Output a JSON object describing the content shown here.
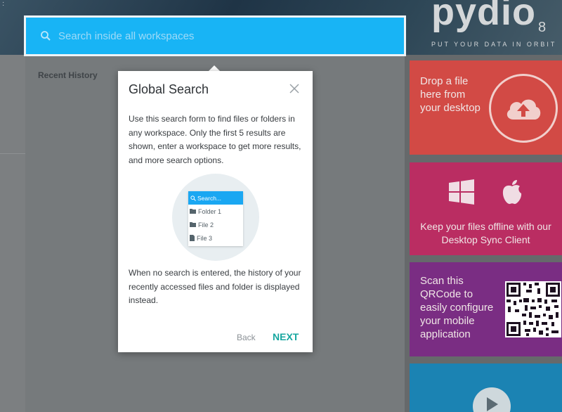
{
  "brand": {
    "logo_text": "pydio",
    "version": "8",
    "tagline": "PUT YOUR DATA IN ORBIT"
  },
  "search": {
    "placeholder": "Search inside all workspaces"
  },
  "sidebar": {
    "recent_history_label": "Recent History"
  },
  "modal": {
    "title": "Global Search",
    "intro": "Use this search form to find files or folders in any workspace. Only the first 5 results are shown, enter a workspace to get more results, and more search options.",
    "illustration": {
      "search_label": "Search...",
      "items": [
        {
          "label": "Folder 1",
          "icon": "folder-icon"
        },
        {
          "label": "File 2",
          "icon": "folder-icon"
        },
        {
          "label": "File 3",
          "icon": "file-icon"
        }
      ]
    },
    "history_note": "When no search is entered, the history of your recently accessed files and folder is displayed instead.",
    "back_label": "Back",
    "next_label": "NEXT"
  },
  "cards": {
    "drop": {
      "text": "Drop a file here from your desktop",
      "icon": "cloud-upload-icon",
      "color": "#d24a45"
    },
    "sync": {
      "text": "Keep your files offline with our Desktop Sync Client",
      "icons": [
        "windows-icon",
        "apple-icon"
      ],
      "color": "#ba2d62"
    },
    "mobile": {
      "text": "Scan this QRCode to easily configure your mobile application",
      "icon": "qr-code",
      "color": "#7a2d83"
    },
    "video": {
      "icon": "play-icon",
      "color": "#1b83b3"
    }
  },
  "colors": {
    "search_bar": "#18b4f5",
    "next_button": "#18a7a0"
  }
}
